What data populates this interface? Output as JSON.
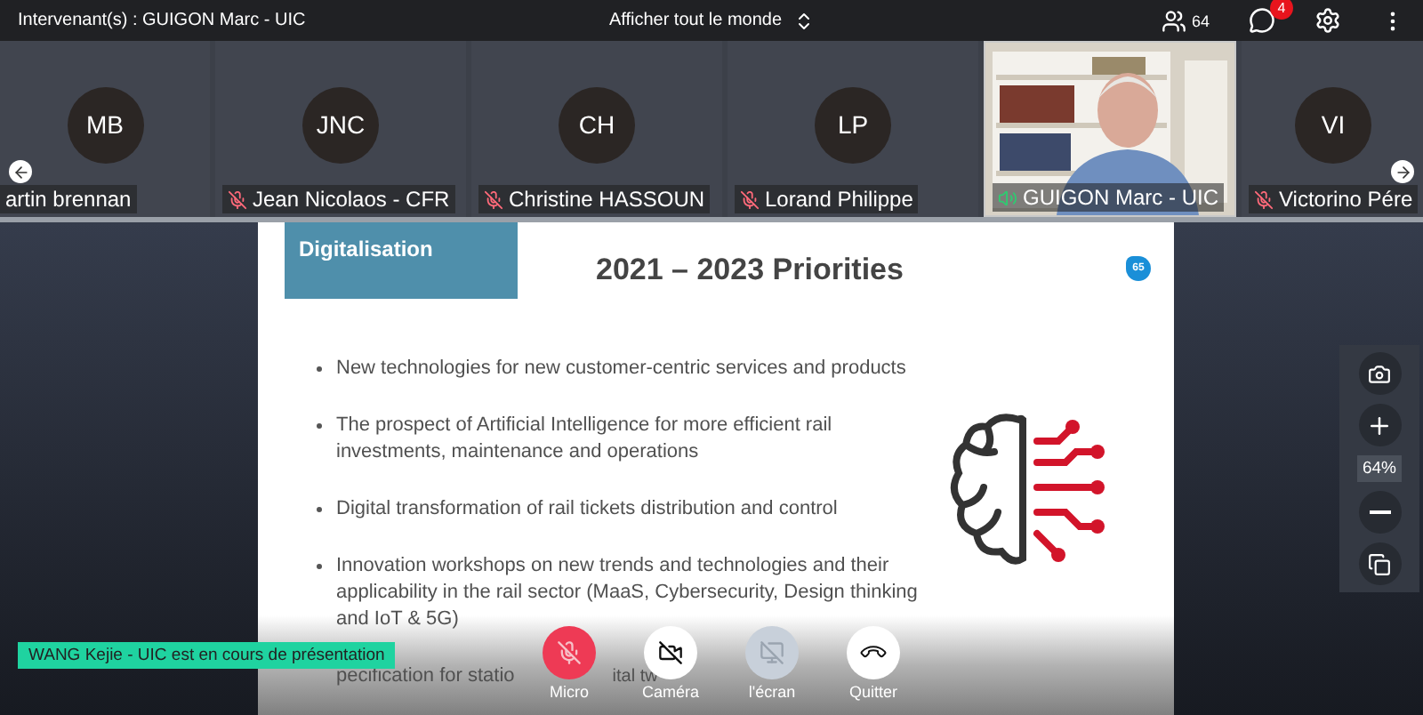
{
  "top_bar": {
    "speakers": "Intervenant(s) : GUIGON Marc  - UIC",
    "view_toggle": "Afficher tout le monde",
    "participant_count": "64",
    "chat_badge": "4"
  },
  "participants": [
    {
      "kind": "avatar",
      "initials": "MB",
      "name": "artin brennan",
      "muted": false,
      "speaking": false,
      "highlighted": false
    },
    {
      "kind": "avatar",
      "initials": "JNC",
      "name": "Jean Nicolaos - CFR",
      "muted": true,
      "speaking": false,
      "highlighted": false
    },
    {
      "kind": "avatar",
      "initials": "CH",
      "name": "Christine HASSOUN",
      "muted": true,
      "speaking": false,
      "highlighted": false
    },
    {
      "kind": "avatar",
      "initials": "LP",
      "name": "Lorand Philippe",
      "muted": true,
      "speaking": false,
      "highlighted": false
    },
    {
      "kind": "video",
      "name": "GUIGON Marc  - UIC",
      "muted": false,
      "speaking": true,
      "highlighted": true
    },
    {
      "kind": "avatar",
      "initials": "VI",
      "name": "Victorino Pére",
      "muted": true,
      "speaking": false,
      "highlighted": false
    }
  ],
  "slide": {
    "section": "Digitalisation",
    "title": "2021 – 2023 Priorities",
    "page_badge": "65",
    "bullets": [
      {
        "lines": [
          "New technologies for new customer-centric services and products"
        ]
      },
      {
        "lines": [
          "The prospect of Artificial Intelligence for more efficient rail",
          "investments, maintenance and operations"
        ]
      },
      {
        "lines": [
          "Digital transformation of rail tickets distribution and control"
        ]
      },
      {
        "lines": [
          "Innovation workshops on new trends and technologies and their",
          "applicability in the rail sector (MaaS, Cybersecurity, Design thinking",
          "and IoT & 5G)"
        ]
      },
      {
        "kind": "partial",
        "fragments": [
          "pecification for statio",
          "ital tw"
        ]
      }
    ]
  },
  "presenter_banner": "WANG Kejie - UIC est en cours de présentation",
  "controls": [
    {
      "kind": "mic",
      "label": "Micro",
      "highlighted": true,
      "disabled": false
    },
    {
      "kind": "camera",
      "label": "Caméra",
      "highlighted": false,
      "disabled": false
    },
    {
      "kind": "screen",
      "label": "l'écran",
      "highlighted": false,
      "disabled": true
    },
    {
      "kind": "leave",
      "label": "Quitter",
      "highlighted": false,
      "disabled": false
    }
  ],
  "zoom": {
    "level": "64%"
  }
}
